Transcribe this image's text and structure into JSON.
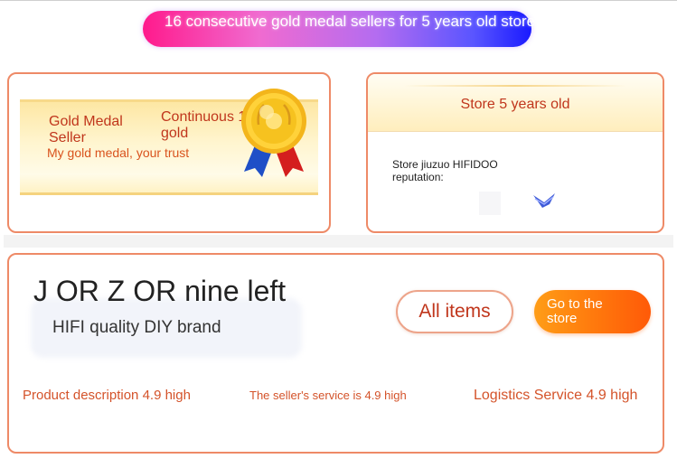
{
  "banner": {
    "text": "16 consecutive gold medal sellers for 5 years old store"
  },
  "gold_medal": {
    "title": "Gold Medal Seller",
    "continuous": "Continuous 16 gold",
    "trust": "My gold medal, your trust"
  },
  "store_age": {
    "title": "Store 5 years old",
    "reputation": "Store jiuzuo HIFIDOO reputation:"
  },
  "brand": {
    "name": "J OR Z OR nine left",
    "subtitle": "HIFI quality DIY brand"
  },
  "buttons": {
    "all_items": "All items",
    "go_to_store": "Go to the store"
  },
  "ratings": {
    "product": "Product description 4.9 high",
    "service": "The seller's service is 4.9 high",
    "logistics": "Logistics Service 4.9 high"
  },
  "colors": {
    "accent_red": "#c0361c",
    "border_orange": "#ee8a67",
    "button_orange": "#ff7a0d",
    "banner_pink": "#ff1a8c",
    "banner_blue": "#1a1aff",
    "gold": "#f5c518"
  },
  "icons": {
    "medal": "gold-medal-icon",
    "reputation": "reputation-badge-icon"
  }
}
